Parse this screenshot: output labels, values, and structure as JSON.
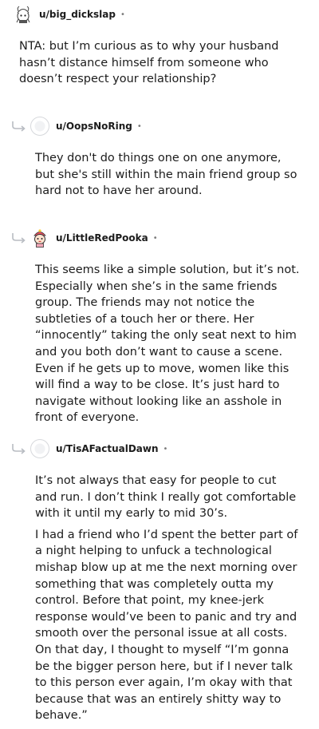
{
  "comments": [
    {
      "username": "u/big_dickslap",
      "separator": "•",
      "avatar_icon": "cartoon-avatar-icon",
      "is_reply": false,
      "paragraphs": [
        "NTA: but I’m curious as to why your husband hasn’t distance himself from someone who doesn’t respect your relationship?"
      ]
    },
    {
      "username": "u/OopsNoRing",
      "separator": "•",
      "avatar_icon": "default-avatar-icon",
      "is_reply": true,
      "paragraphs": [
        "They don't do things one on one anymore, but she's still within the main friend group so hard not to have her around."
      ]
    },
    {
      "username": "u/LittleRedPooka",
      "separator": "•",
      "avatar_icon": "cartoon-avatar-icon",
      "is_reply": true,
      "paragraphs": [
        "This seems like a simple solution, but it’s not. Especially when she’s in the same friends group. The friends may not notice the subtleties of a touch her or there. Her “innocently” taking the only seat next to him and you both don’t want to cause a scene. Even if he gets up to move, women like this will find a way to be close. It’s just hard to navigate without looking like an asshole in front of everyone."
      ]
    },
    {
      "username": "u/TisAFactualDawn",
      "separator": "•",
      "avatar_icon": "default-avatar-icon",
      "is_reply": true,
      "paragraphs": [
        "It’s not always that easy for people to cut and run. I don’t think I really got comfortable with it until my early to mid 30’s.",
        "I had a friend who I’d spent the better part of a night helping to unfuck a technological mishap blow up at me the next morning over something that was completely outta my control. Before that point, my knee-jerk response would’ve been to panic and try and smooth over the personal issue at all costs. On that day, I thought to myself “I’m gonna be the bigger person here, but if I never talk to this person ever again, I’m okay with that because that was an entirely shitty way to behave.”"
      ]
    }
  ]
}
